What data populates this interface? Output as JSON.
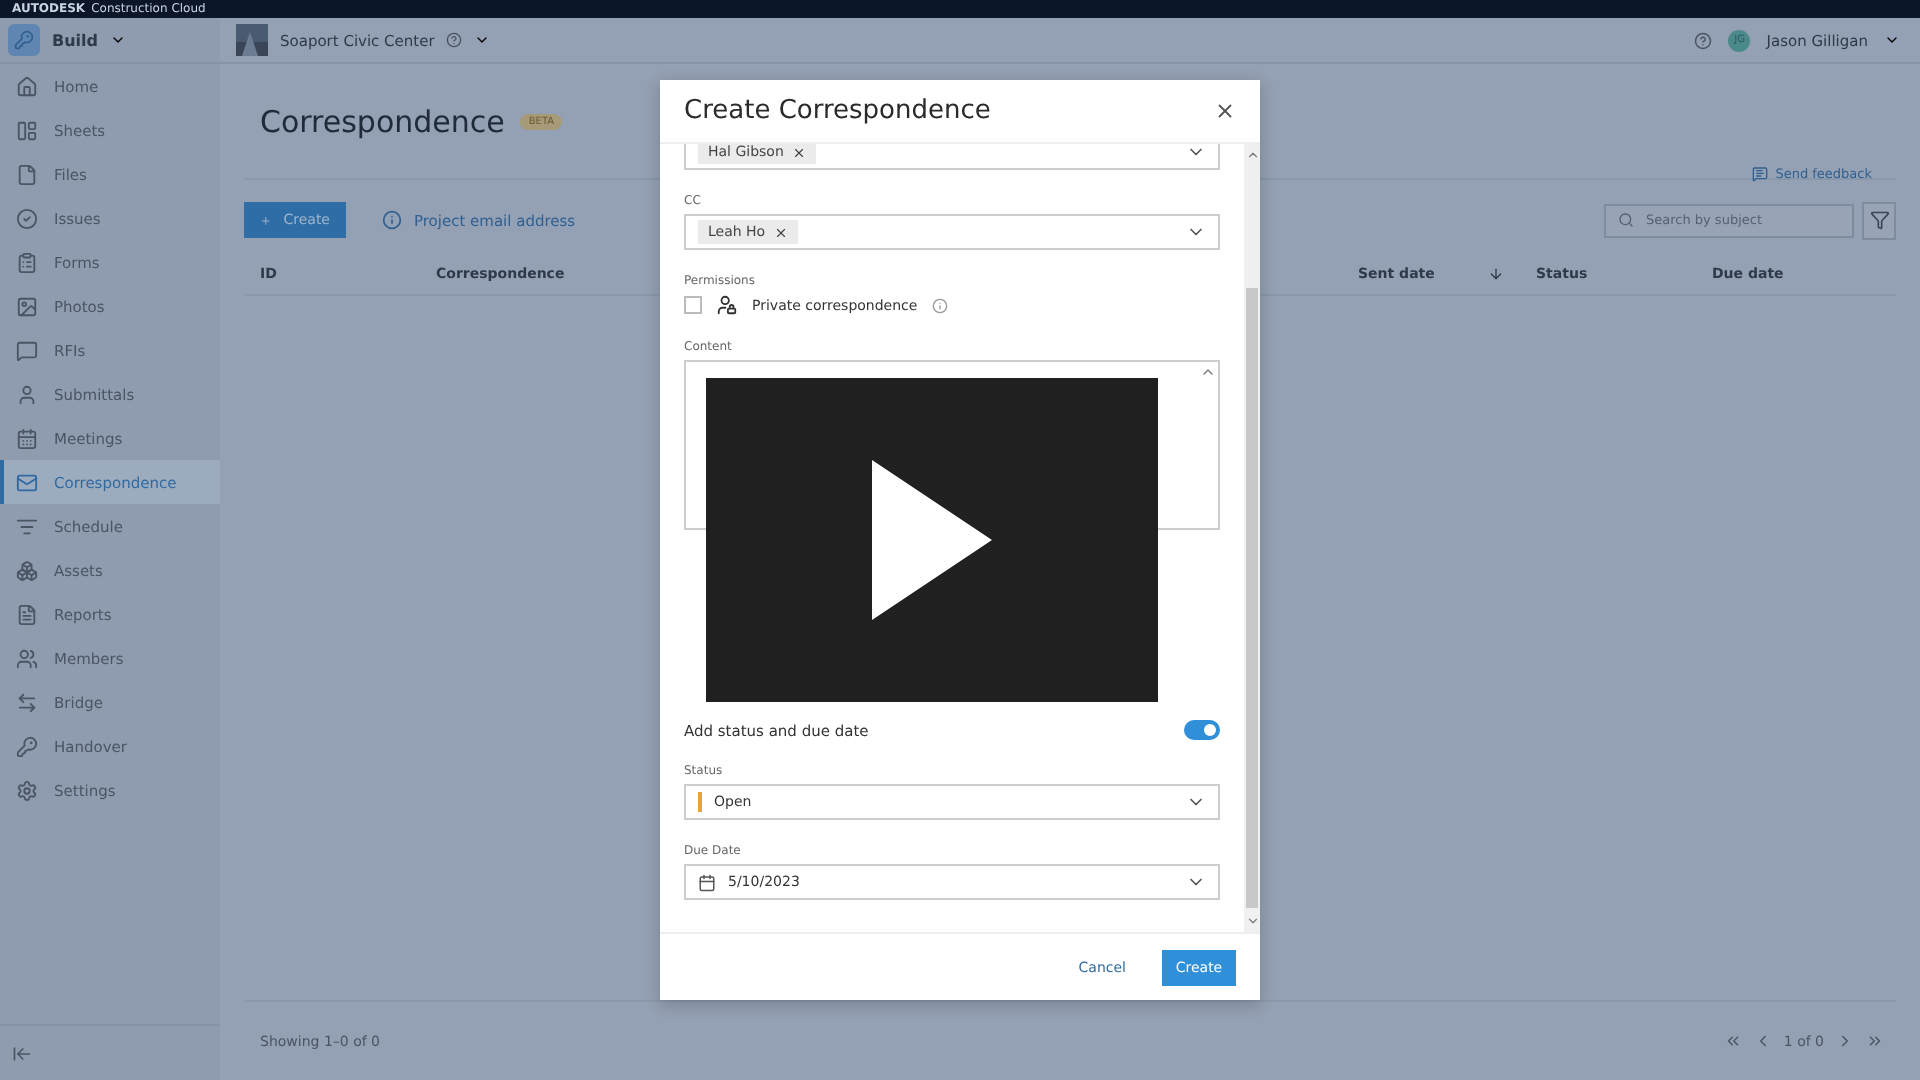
{
  "brand_bar": {
    "brand": "AUTODESK",
    "product": "Construction Cloud"
  },
  "header": {
    "module": "Build",
    "project": "Soaport Civic Center",
    "user": {
      "initials": "JG",
      "name": "Jason Gilligan"
    }
  },
  "sidebar": {
    "items": [
      {
        "label": "Home",
        "selected": false
      },
      {
        "label": "Sheets",
        "selected": false
      },
      {
        "label": "Files",
        "selected": false
      },
      {
        "label": "Issues",
        "selected": false
      },
      {
        "label": "Forms",
        "selected": false
      },
      {
        "label": "Photos",
        "selected": false
      },
      {
        "label": "RFIs",
        "selected": false
      },
      {
        "label": "Submittals",
        "selected": false
      },
      {
        "label": "Meetings",
        "selected": false
      },
      {
        "label": "Correspondence",
        "selected": true
      },
      {
        "label": "Schedule",
        "selected": false
      },
      {
        "label": "Assets",
        "selected": false
      },
      {
        "label": "Reports",
        "selected": false
      },
      {
        "label": "Members",
        "selected": false
      },
      {
        "label": "Bridge",
        "selected": false
      },
      {
        "label": "Handover",
        "selected": false
      },
      {
        "label": "Settings",
        "selected": false
      }
    ]
  },
  "page": {
    "title": "Correspondence",
    "badge": "BETA",
    "feedback": "Send feedback",
    "create": "Create",
    "email_link": "Project email address",
    "search": {
      "placeholder": "Search by subject"
    }
  },
  "table": {
    "columns": [
      {
        "label": "ID",
        "sorted": false
      },
      {
        "label": "Correspondence",
        "sorted": false
      },
      {
        "label": "Sent date",
        "sorted": true
      },
      {
        "label": "Status",
        "sorted": false
      },
      {
        "label": "Due date",
        "sorted": false
      }
    ]
  },
  "footer": {
    "summary": "Showing 1–0 of 0",
    "page": "1 of 0"
  },
  "dialog": {
    "title": "Create Correspondence",
    "fields": [
      {
        "kind": "chips",
        "chips": [
          "Hal Gibson"
        ]
      },
      {
        "kind": "chips",
        "label": "CC",
        "chips": [
          "Leah Ho"
        ]
      },
      {
        "kind": "checkbox",
        "label": "Permissions",
        "text": "Private correspondence",
        "checked": false
      },
      {
        "kind": "textarea",
        "label": "Content"
      }
    ],
    "toggle": {
      "label": "Add status and due date",
      "on": true
    },
    "status": {
      "label": "Status",
      "value": "Open",
      "color": "#e8a33a"
    },
    "due": {
      "label": "Due Date",
      "value": "5/10/2023"
    },
    "cancel": "Cancel",
    "submit": "Create"
  }
}
